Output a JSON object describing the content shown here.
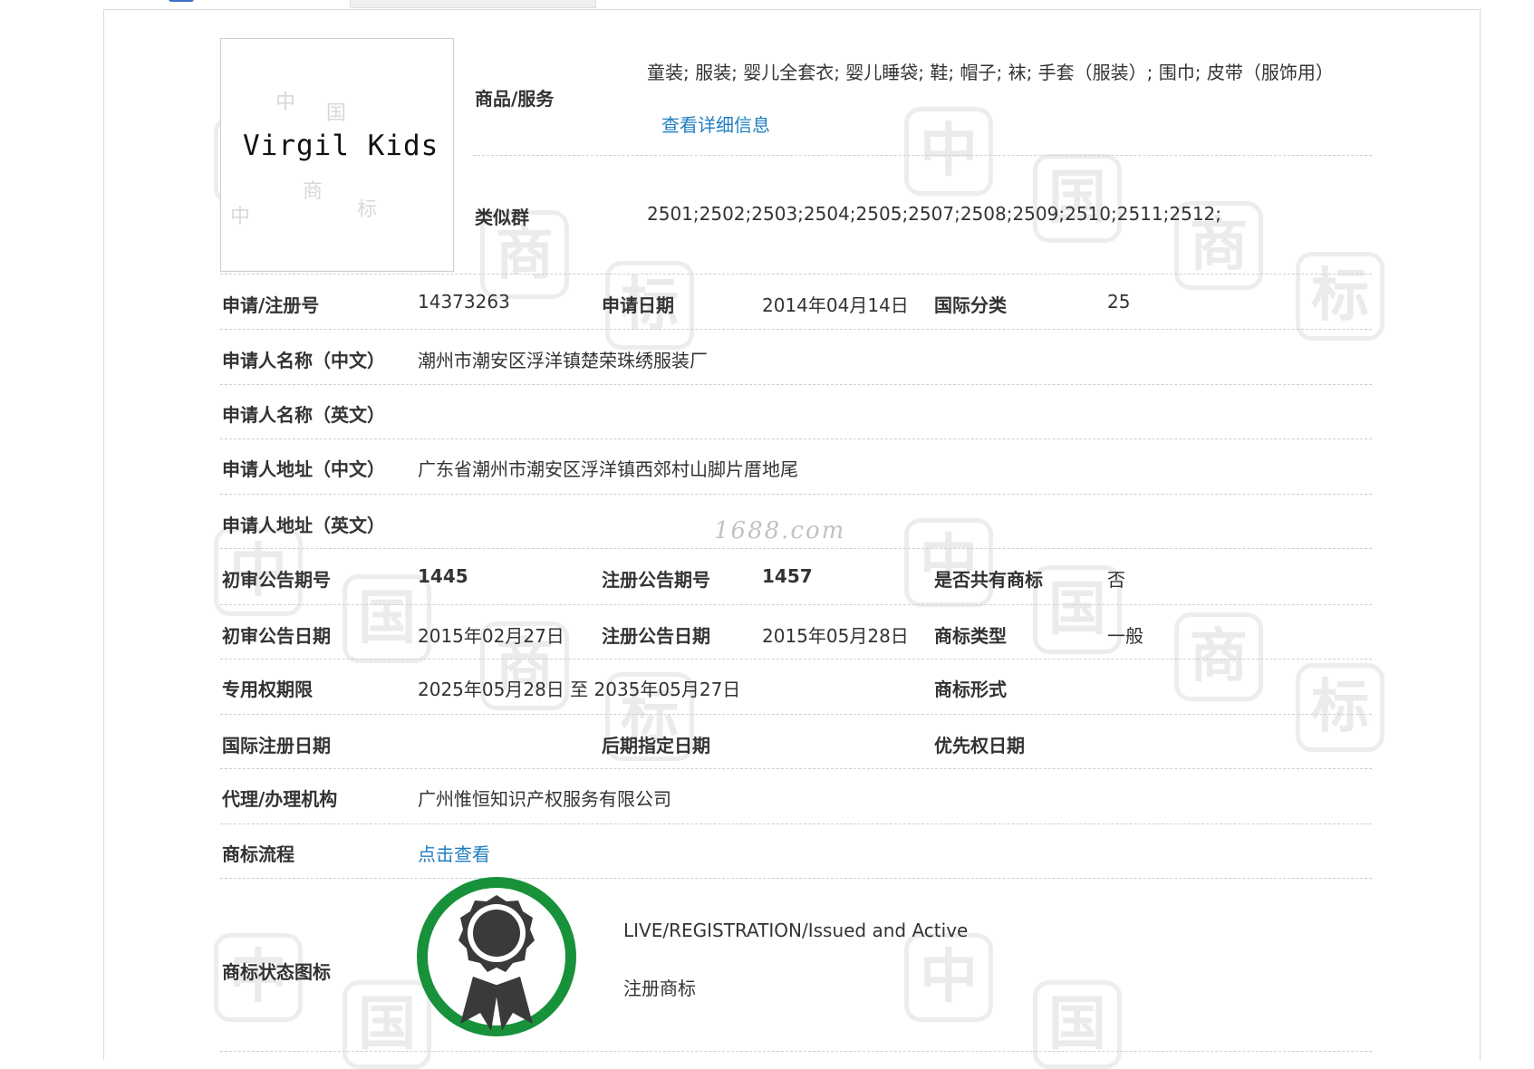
{
  "logo": {
    "text": "Virgil Kids"
  },
  "goods": {
    "label": "商品/服务",
    "value": "童装; 服装; 婴儿全套衣; 婴儿睡袋; 鞋; 帽子; 袜; 手套（服装）; 围巾; 皮带（服饰用）",
    "detail_link": "查看详细信息"
  },
  "similar_group": {
    "label": "类似群",
    "value": "2501;2502;2503;2504;2505;2507;2508;2509;2510;2511;2512;"
  },
  "row_reg": {
    "reg_no_label": "申请/注册号",
    "reg_no": "14373263",
    "app_date_label": "申请日期",
    "app_date": "2014年04月14日",
    "intl_class_label": "国际分类",
    "intl_class": "25"
  },
  "applicant_cn": {
    "label": "申请人名称（中文）",
    "value": "潮州市潮安区浮洋镇楚荣珠绣服装厂"
  },
  "applicant_en": {
    "label": "申请人名称（英文）",
    "value": ""
  },
  "address_cn": {
    "label": "申请人地址（中文）",
    "value": "广东省潮州市潮安区浮洋镇西郊村山脚片厝地尾"
  },
  "address_en": {
    "label": "申请人地址（英文）",
    "value": ""
  },
  "row_gazette_no": {
    "prelim_no_label": "初审公告期号",
    "prelim_no": "1445",
    "reg_no_label": "注册公告期号",
    "reg_no": "1457",
    "shared_label": "是否共有商标",
    "shared": "否"
  },
  "row_gazette_date": {
    "prelim_date_label": "初审公告日期",
    "prelim_date": "2015年02月27日",
    "reg_date_label": "注册公告日期",
    "reg_date": "2015年05月28日",
    "type_label": "商标类型",
    "type": "一般"
  },
  "row_term": {
    "term_label": "专用权期限",
    "term": "2025年05月28日 至 2035年05月27日",
    "form_label": "商标形式",
    "form": ""
  },
  "row_intl": {
    "intl_reg_label": "国际注册日期",
    "intl_reg": "",
    "later_label": "后期指定日期",
    "later": "",
    "priority_label": "优先权日期",
    "priority": ""
  },
  "agent": {
    "label": "代理/办理机构",
    "value": "广州惟恒知识产权服务有限公司"
  },
  "flow": {
    "label": "商标流程",
    "link": "点击查看"
  },
  "status": {
    "label": "商标状态图标",
    "en": "LIVE/REGISTRATION/Issued and Active",
    "cn": "注册商标",
    "ring_color": "#17913a",
    "medal_color": "#3a3a3a"
  },
  "watermark": {
    "site": "1688.com",
    "chars": [
      "中",
      "国",
      "商",
      "标"
    ]
  }
}
